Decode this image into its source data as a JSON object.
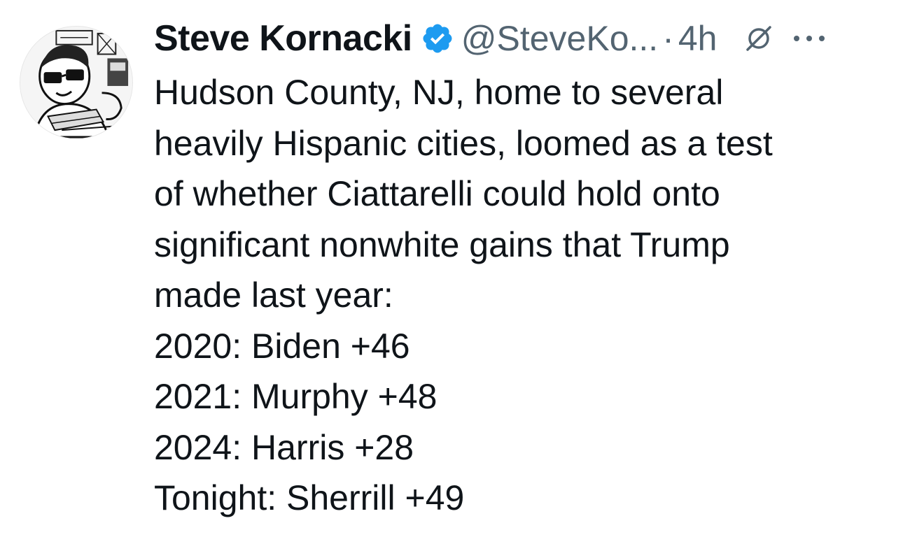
{
  "tweet": {
    "author": {
      "display_name": "Steve Kornacki",
      "handle": "@SteveKo...",
      "verified": true,
      "avatar_icon": "cartoon-avatar"
    },
    "separator": "·",
    "time": "4h",
    "icons": {
      "verified": "verified-badge-icon",
      "grok": "grok-icon",
      "more": "more-options-icon"
    },
    "colors": {
      "text": "#0f1419",
      "muted": "#536471",
      "verified_blue": "#1d9bf0"
    },
    "lines": [
      "Hudson County, NJ, home to several",
      "heavily Hispanic cities, loomed as a test",
      "of whether Ciattarelli could hold onto",
      "significant nonwhite gains that Trump",
      "made last year:",
      "2020: Biden +46",
      "2021: Murphy +48",
      "2024: Harris +28",
      "Tonight: Sherrill +49"
    ]
  }
}
